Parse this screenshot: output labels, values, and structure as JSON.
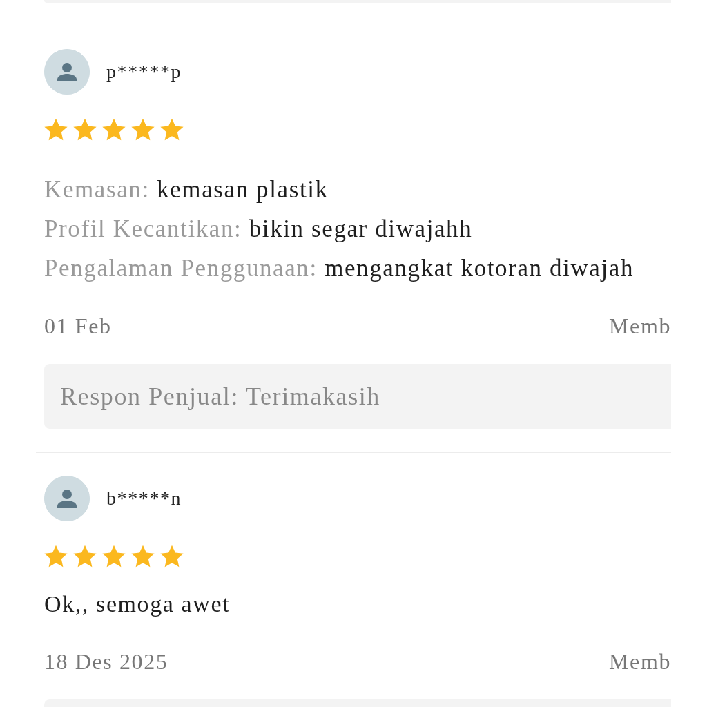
{
  "reviews": [
    {
      "name": "p*****p",
      "stars": 5,
      "attributes": [
        {
          "label": "Kemasan:",
          "value": "kemasan plastik"
        },
        {
          "label": "Profil Kecantikan:",
          "value": "bikin segar diwajahh"
        },
        {
          "label": "Pengalaman Penggunaan:",
          "value": "mengangkat kotoran diwajah"
        }
      ],
      "date": "01 Feb",
      "member": "Memb",
      "response_shown": true,
      "response": "Respon Penjual: Terimakasih"
    },
    {
      "name": "b*****n",
      "stars": 5,
      "text": "Ok,, semoga awet",
      "date": "18 Des 2025",
      "member": "Memb",
      "response_shown": true
    }
  ]
}
